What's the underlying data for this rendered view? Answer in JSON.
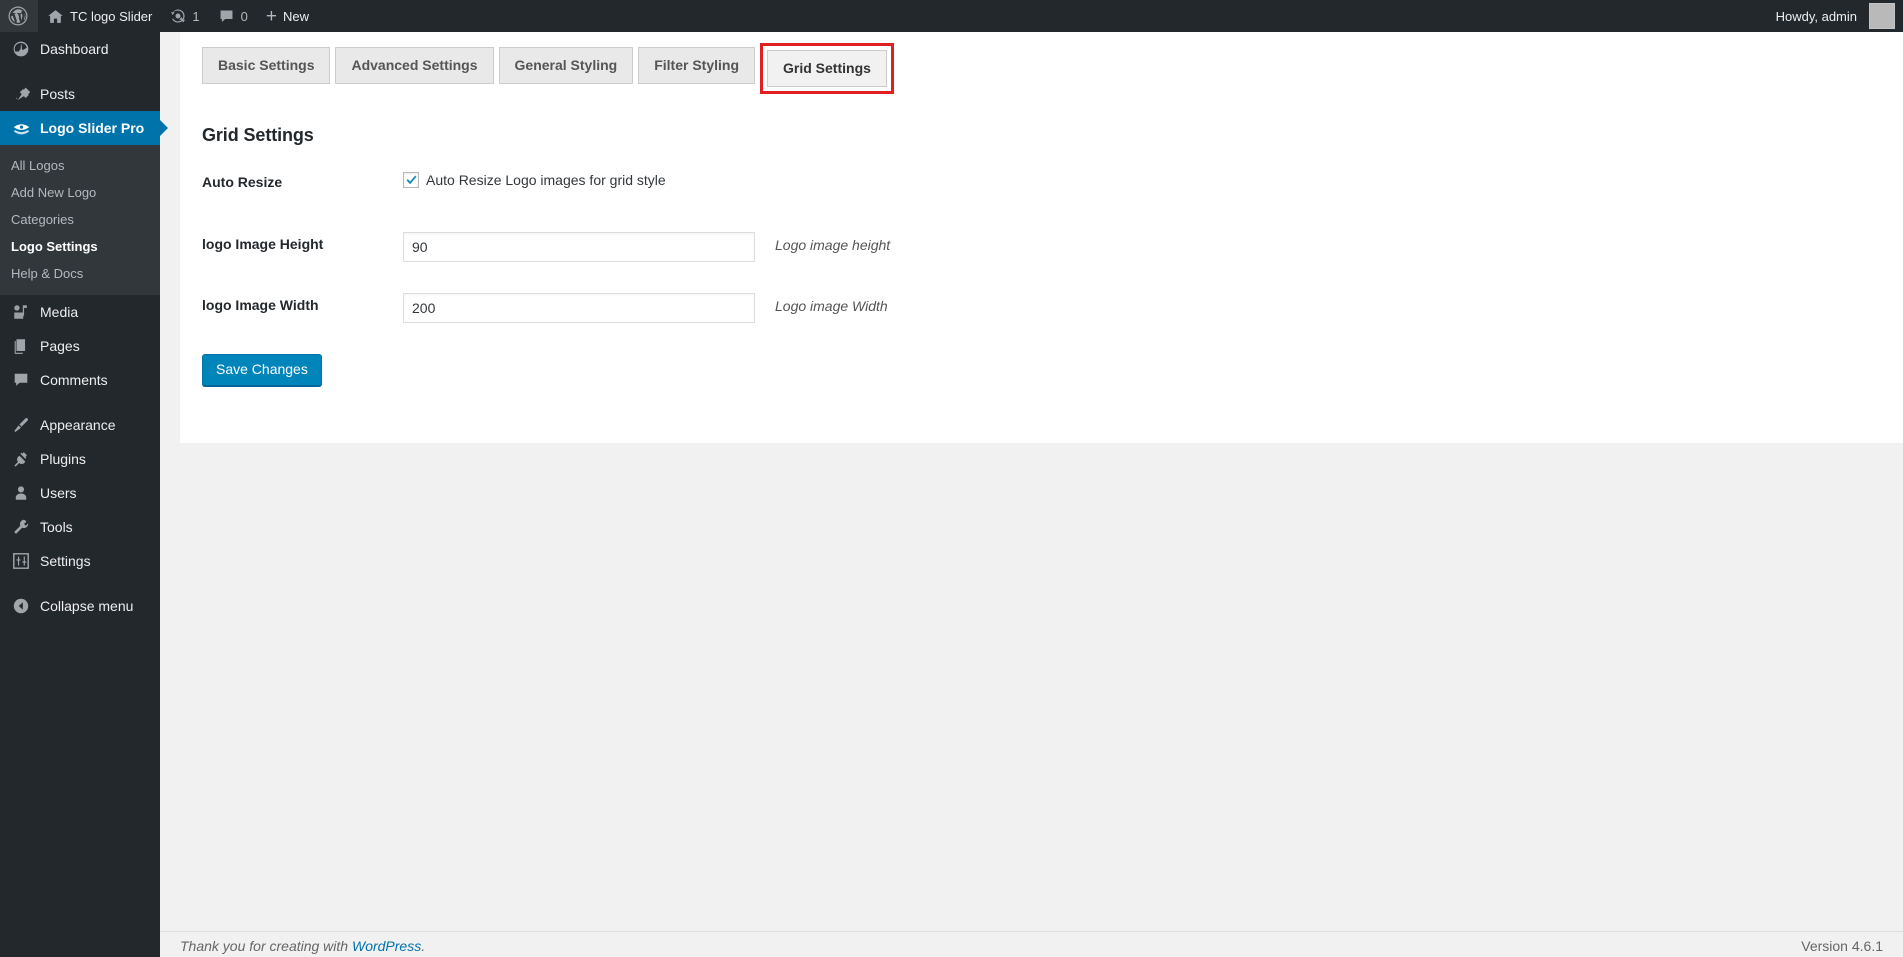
{
  "admin_bar": {
    "wp_logo_icon": "wordpress-logo-icon",
    "site_home_icon": "home-icon",
    "site_name": "TC logo Slider",
    "updates_icon": "updates-icon",
    "updates_count": "1",
    "comments_icon": "comment-bubble-icon",
    "comments_count": "0",
    "new_icon": "plus-icon",
    "new_label": "New",
    "howdy": "Howdy, admin",
    "avatar_icon": "avatar"
  },
  "sidebar": {
    "items": [
      {
        "label": "Dashboard",
        "icon": "dashboard-icon",
        "current": false
      },
      {
        "label": "Posts",
        "icon": "pin-icon",
        "current": false
      },
      {
        "label": "Logo Slider Pro",
        "icon": "logo-slider-icon",
        "current": true
      }
    ],
    "submenu": [
      {
        "label": "All Logos",
        "current": false
      },
      {
        "label": "Add New Logo",
        "current": false
      },
      {
        "label": "Categories",
        "current": false
      },
      {
        "label": "Logo Settings",
        "current": true
      },
      {
        "label": "Help & Docs",
        "current": false
      }
    ],
    "items2": [
      {
        "label": "Media",
        "icon": "media-icon"
      },
      {
        "label": "Pages",
        "icon": "pages-icon"
      },
      {
        "label": "Comments",
        "icon": "comment-bubble-icon"
      }
    ],
    "items3": [
      {
        "label": "Appearance",
        "icon": "paintbrush-icon"
      },
      {
        "label": "Plugins",
        "icon": "plug-icon"
      },
      {
        "label": "Users",
        "icon": "user-icon"
      },
      {
        "label": "Tools",
        "icon": "wrench-icon"
      },
      {
        "label": "Settings",
        "icon": "sliders-icon"
      }
    ],
    "collapse": {
      "label": "Collapse menu",
      "icon": "collapse-arrow-icon"
    }
  },
  "tabs": [
    {
      "label": "Basic Settings",
      "active": false,
      "highlighted": false
    },
    {
      "label": "Advanced Settings",
      "active": false,
      "highlighted": false
    },
    {
      "label": "General Styling",
      "active": false,
      "highlighted": false
    },
    {
      "label": "Filter Styling",
      "active": false,
      "highlighted": false
    },
    {
      "label": "Grid Settings",
      "active": true,
      "highlighted": true
    }
  ],
  "highlight_color": "#e02020",
  "accent_color": "#0073aa",
  "main": {
    "heading": "Grid Settings",
    "fields": {
      "auto_resize": {
        "label": "Auto Resize",
        "checkbox_label": "Auto Resize Logo images for grid style",
        "checked": true
      },
      "logo_image_height": {
        "label": "logo Image Height",
        "value": "90",
        "placeholder": "",
        "hint": "Logo image height"
      },
      "logo_image_width": {
        "label": "logo Image Width",
        "value": "200",
        "placeholder": "",
        "hint": "Logo image Width"
      }
    },
    "save_label": "Save Changes"
  },
  "footer": {
    "thanks_prefix": "Thank you for creating with ",
    "thanks_link": "WordPress",
    "version": "Version 4.6.1"
  }
}
